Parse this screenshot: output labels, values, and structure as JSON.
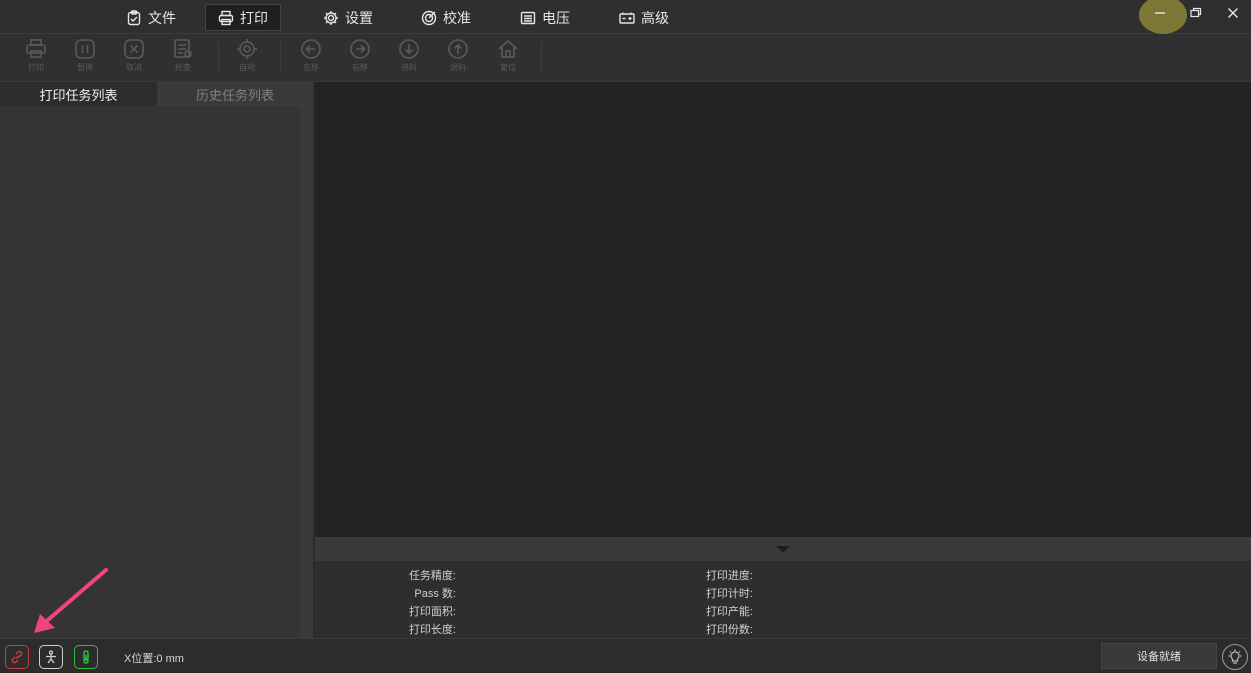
{
  "menu": {
    "items": [
      {
        "label": "文件",
        "icon": "clipboard-check-icon"
      },
      {
        "label": "打印",
        "icon": "printer-icon",
        "active": true
      },
      {
        "label": "设置",
        "icon": "gear-icon"
      },
      {
        "label": "校准",
        "icon": "target-icon"
      },
      {
        "label": "电压",
        "icon": "list-icon"
      },
      {
        "label": "高级",
        "icon": "battery-icon"
      }
    ]
  },
  "toolbar": {
    "items": [
      {
        "label": "打印",
        "icon": "printer-icon"
      },
      {
        "label": "暂停",
        "icon": "pause-icon"
      },
      {
        "label": "取消",
        "icon": "cancel-icon"
      },
      {
        "label": "检查",
        "icon": "check-doc-icon"
      },
      {
        "label": "自动",
        "icon": "crosshair-icon"
      },
      {
        "label": "左移",
        "icon": "arrow-left-icon"
      },
      {
        "label": "右移",
        "icon": "arrow-right-icon"
      },
      {
        "label": "进料",
        "icon": "arrow-down-icon"
      },
      {
        "label": "退料",
        "icon": "arrow-up-icon"
      },
      {
        "label": "复位",
        "icon": "home-icon"
      }
    ]
  },
  "tabs": {
    "current": "打印任务列表",
    "history": "历史任务列表"
  },
  "info": {
    "task_precision": "任务精度:",
    "pass_count": "Pass 数:",
    "print_area": "打印面积:",
    "print_length": "打印长度:",
    "print_progress": "打印进度:",
    "print_timer": "打印计时:",
    "print_capacity": "打印产能:",
    "print_copies": "打印份数:"
  },
  "status": {
    "x_position": "X位置:0 mm",
    "device_ready": "设备就绪"
  },
  "colors": {
    "connection_error": "#d03a3a",
    "temperature_ok": "#2fbf3f",
    "annotation_arrow": "#f0447a"
  }
}
